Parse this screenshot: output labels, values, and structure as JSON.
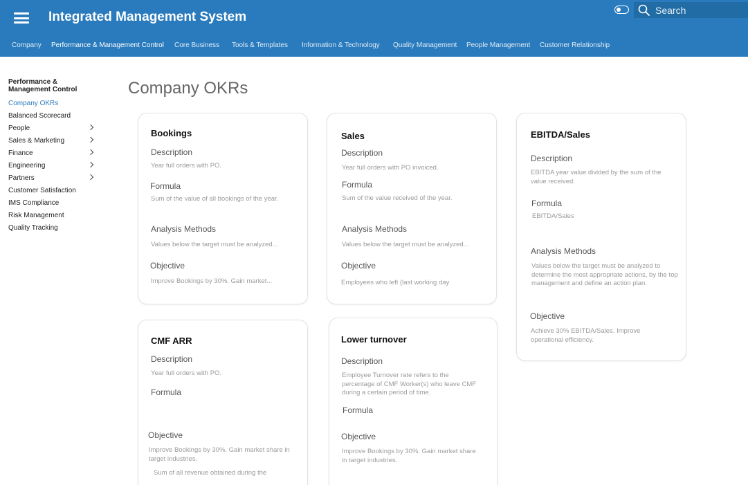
{
  "app": {
    "title": "Integrated Management System"
  },
  "search": {
    "placeholder": "Search"
  },
  "nav": {
    "items": [
      "Company",
      "Performance & Management Control",
      "Core Business",
      "Tools & Templates",
      "Information & Technology",
      "Quality Management",
      "People Management",
      "Customer Relationship"
    ],
    "active_index": 1
  },
  "sidebar": {
    "heading": "Performance & Management Control",
    "items": [
      {
        "label": "Company OKRs",
        "active": true,
        "expandable": false
      },
      {
        "label": "Balanced Scorecard",
        "active": false,
        "expandable": false
      },
      {
        "label": "People",
        "active": false,
        "expandable": true
      },
      {
        "label": "Sales & Marketing",
        "active": false,
        "expandable": true
      },
      {
        "label": "Finance",
        "active": false,
        "expandable": true
      },
      {
        "label": "Engineering",
        "active": false,
        "expandable": true
      },
      {
        "label": "Partners",
        "active": false,
        "expandable": true
      },
      {
        "label": "Customer Satisfaction",
        "active": false,
        "expandable": false
      },
      {
        "label": "IMS Compliance",
        "active": false,
        "expandable": false
      },
      {
        "label": "Risk Management",
        "active": false,
        "expandable": false
      },
      {
        "label": "Quality Tracking",
        "active": false,
        "expandable": false
      }
    ]
  },
  "main": {
    "page_title": "Company OKRs",
    "cards": {
      "bookings": {
        "title": "Bookings",
        "description_label": "Description",
        "description": "Year full orders with PO.",
        "formula_label": "Formula",
        "formula": "Sum of the value of all bookings of the year.",
        "analysis_label": "Analysis Methods",
        "analysis": "Values below the target must be analyzed...",
        "objective_label": "Objective",
        "objective": "Improve Bookings by 30%. Gain market..."
      },
      "sales": {
        "title": "Sales",
        "description_label": "Description",
        "description": "Year full orders with PO invoiced.",
        "formula_label": "Formula",
        "formula": "Sum of the value received of the year.",
        "analysis_label": "Analysis Methods",
        "analysis": "Values below the target must be analyzed...",
        "objective_label": "Objective",
        "objective": "Employees who left (last working day"
      },
      "ebitda": {
        "title": "EBITDA/Sales",
        "description_label": "Description",
        "description": "EBITDA year value divided by the sum of the value received.",
        "formula_label": "Formula",
        "formula": "EBITDA/Sales",
        "analysis_label": "Analysis Methods",
        "analysis": "Values below the target must be analyzed to determine the most appropriate actions, by the top management and define an action plan.",
        "objective_label": "Objective",
        "objective": "Achieve 30% EBITDA/Sales. Improve operational efficiency."
      },
      "cmf_arr": {
        "title": "CMF ARR",
        "description_label": "Description",
        "description": "Year full orders with PO.",
        "formula_label": "Formula",
        "objective_label": "Objective",
        "objective": "Improve Bookings by 30%. Gain market share in target industries.",
        "extra": "Sum of all revenue obtained during the"
      },
      "lower_turnover": {
        "title": "Lower turnover",
        "description_label": "Description",
        "description": "Employee Turnover rate refers to the percentage of CMF Worker(s) who leave CMF during a certain period of time.",
        "formula_label": "Formula",
        "objective_label": "Objective",
        "objective": "Improve Bookings by 30%. Gain market share in target industries."
      }
    }
  },
  "colors": {
    "header_bg": "#2a7bbd",
    "search_bg": "#226ca6",
    "accent": "#2a7bbd"
  },
  "icons": {
    "menu": "hamburger-menu-icon",
    "toggle": "toggle-switch-icon",
    "search": "search-icon",
    "chevron": "chevron-right-icon"
  }
}
